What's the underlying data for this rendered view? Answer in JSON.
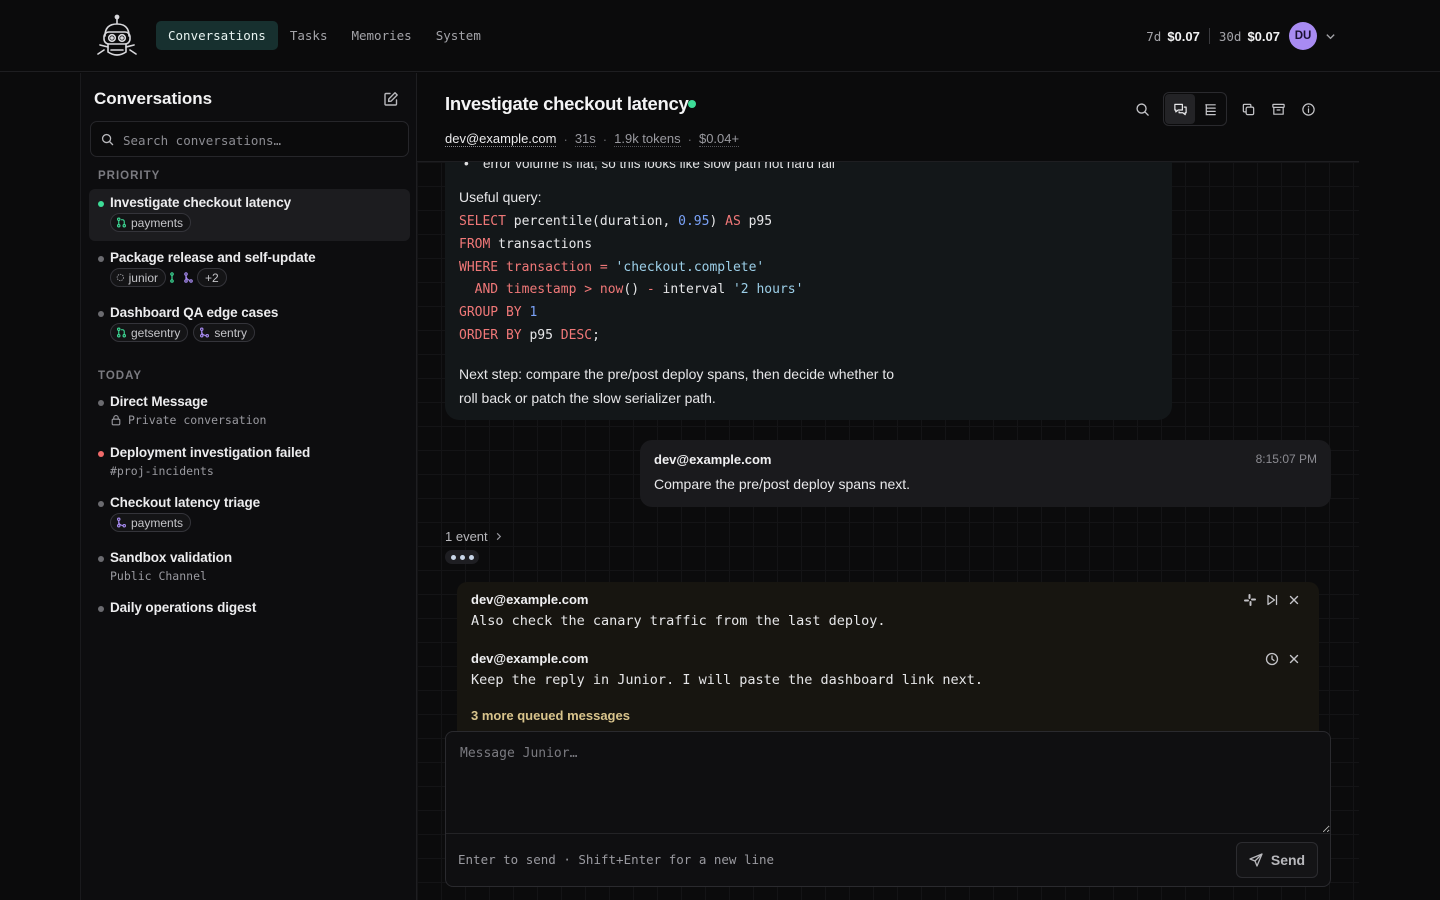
{
  "nav": {
    "tabs": [
      {
        "label": "Conversations",
        "active": true
      },
      {
        "label": "Tasks",
        "active": false
      },
      {
        "label": "Memories",
        "active": false
      },
      {
        "label": "System",
        "active": false
      }
    ]
  },
  "cost": {
    "week_label": "7d",
    "week_value": "$0.07",
    "month_label": "30d",
    "month_value": "$0.07",
    "avatar_initials": "DU"
  },
  "sidebar": {
    "title": "Conversations",
    "search_placeholder": "Search conversations…",
    "priority_label": "PRIORITY",
    "today_label": "TODAY",
    "priority": [
      {
        "title": "Investigate checkout latency",
        "dot": "#3ddc97",
        "tags": [
          "payments"
        ]
      },
      {
        "title": "Package release and self-update",
        "dot": "#6b6b70",
        "tags": [
          "junior"
        ],
        "more": "+2"
      },
      {
        "title": "Dashboard QA edge cases",
        "dot": "#6b6b70",
        "tags": [
          "getsentry",
          "sentry"
        ]
      }
    ],
    "today": [
      {
        "title": "Direct Message",
        "sub": "Private conversation",
        "dot": "#6b6b70"
      },
      {
        "title": "Deployment investigation failed",
        "sub": "#proj-incidents",
        "dot": "#f06a6a"
      },
      {
        "title": "Checkout latency triage",
        "tags": [
          "payments"
        ],
        "dot": "#6b6b70"
      },
      {
        "title": "Sandbox validation",
        "sub": "Public Channel",
        "dot": "#6b6b70"
      },
      {
        "title": "Daily operations digest",
        "dot": "#6b6b70"
      }
    ]
  },
  "chat": {
    "title": "Investigate checkout latency",
    "owner": "dev@example.com",
    "duration": "31s",
    "tokens": "1.9k tokens",
    "cost": "$0.04+",
    "assistant": {
      "bullet": "error volume is flat, so this looks like slow path not hard fail",
      "query_label": "Useful query:",
      "next_step_1": "Next step: compare the pre/post deploy spans, then decide whether to",
      "next_step_2": "roll back or patch the slow serializer path."
    },
    "user_message": {
      "author": "dev@example.com",
      "time": "8:15:07 PM",
      "text": "Compare the pre/post deploy spans next."
    },
    "events_label": "1 event",
    "queue": [
      {
        "author": "dev@example.com",
        "text": "Also check the canary traffic from the last deploy."
      },
      {
        "author": "dev@example.com",
        "text": "Keep the reply in Junior. I will paste the dashboard link next."
      }
    ],
    "queue_more": "3 more queued messages",
    "composer": {
      "placeholder": "Message Junior…",
      "hint": "Enter to send · Shift+Enter for a new line",
      "send_label": "Send"
    }
  },
  "colors": {
    "accent": "#3ddc97",
    "active_tab": "#17302f",
    "avatar": "#a88bf2",
    "queue_more": "#d9c48c"
  }
}
